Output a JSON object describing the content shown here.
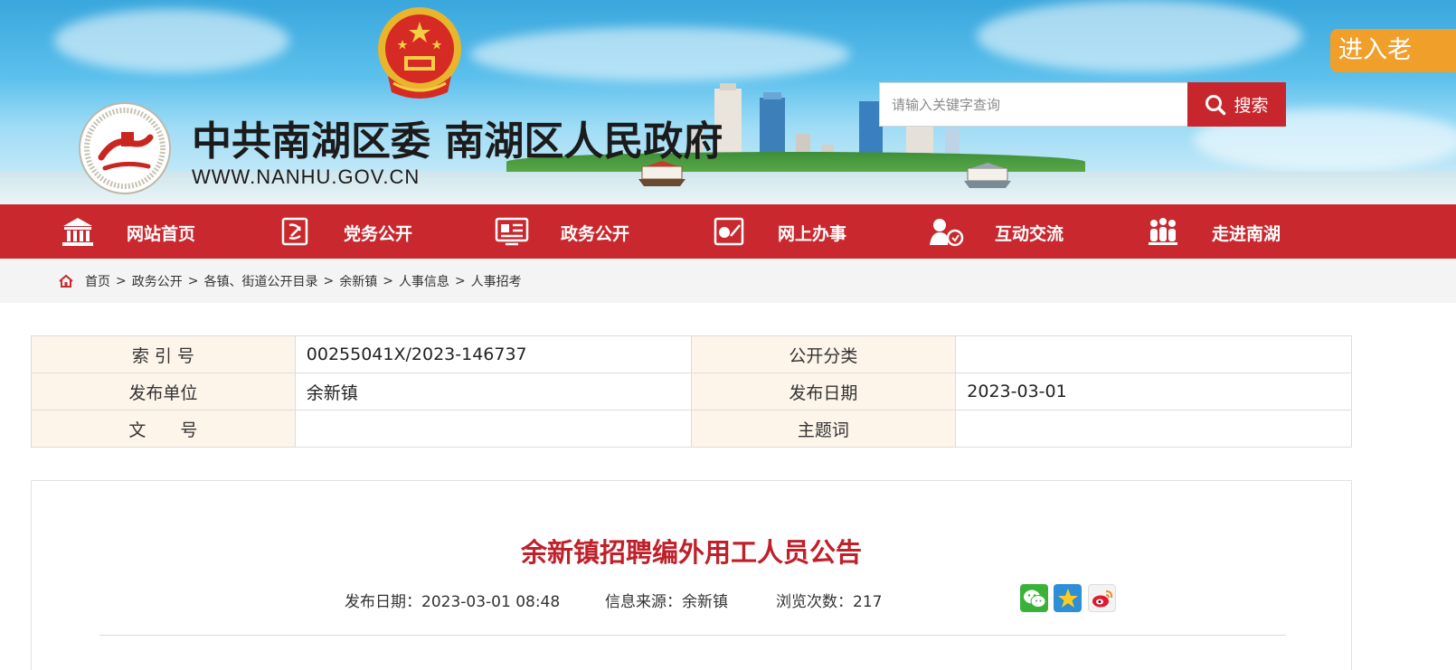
{
  "header": {
    "site_title": "中共南湖区委 南湖区人民政府",
    "site_url": "WWW.NANHU.GOV.CN",
    "search_placeholder": "请输入关键字查询",
    "search_button": "搜索",
    "old_version_button": "进入老",
    "brand_red": "#c9282e",
    "accent_orange": "#f0a02a"
  },
  "nav": {
    "items": [
      {
        "label": "网站首页",
        "icon": "building-icon"
      },
      {
        "label": "党务公开",
        "icon": "party-flag-icon"
      },
      {
        "label": "政务公开",
        "icon": "document-board-icon"
      },
      {
        "label": "网上办事",
        "icon": "online-service-icon"
      },
      {
        "label": "互动交流",
        "icon": "interaction-icon"
      },
      {
        "label": "走进南湖",
        "icon": "people-icon"
      }
    ]
  },
  "breadcrumb": {
    "items": [
      "首页",
      "政务公开",
      "各镇、街道公开目录",
      "余新镇",
      "人事信息",
      "人事招考"
    ],
    "separator": ">"
  },
  "info_table": {
    "index_label": "索 引 号",
    "index_value": "00255041X/2023-146737",
    "category_label": "公开分类",
    "category_value": "",
    "publisher_label": "发布单位",
    "publisher_value": "余新镇",
    "date_label": "发布日期",
    "date_value": "2023-03-01",
    "docno_label": "文　　号",
    "docno_value": "",
    "keyword_label": "主题词",
    "keyword_value": ""
  },
  "article": {
    "title": "余新镇招聘编外用工人员公告",
    "publish_time": "发布日期：2023-03-01 08:48",
    "source": "信息来源：余新镇",
    "views": "浏览次数：217",
    "share_icons": [
      "wechat-icon",
      "qzone-icon",
      "weibo-icon"
    ],
    "title_color": "#c0202a"
  }
}
